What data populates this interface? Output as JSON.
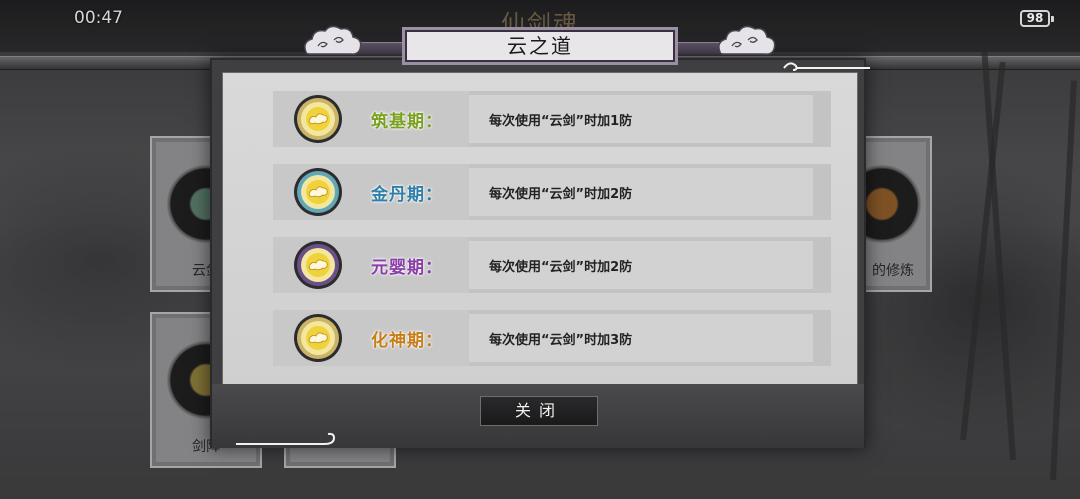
{
  "status_bar": {
    "time": "00:47",
    "battery": "98"
  },
  "background": {
    "game_title": "仙剑魂",
    "tiles": [
      {
        "label": "云剑"
      },
      {
        "label": "剑阵"
      },
      {
        "label": "的修炼"
      }
    ]
  },
  "dialog": {
    "title": "云之道",
    "rows": [
      {
        "stage": "筑基期：",
        "description": "每次使用“云剑”时加1防",
        "stage_color": "#7aa11e",
        "ring_color": "#c9b469"
      },
      {
        "stage": "金丹期：",
        "description": "每次使用“云剑”时加2防",
        "stage_color": "#2f7fa8",
        "ring_color": "#5fa7b9"
      },
      {
        "stage": "元婴期：",
        "description": "每次使用“云剑”时加2防",
        "stage_color": "#8a3ea8",
        "ring_color": "#6b4f8a"
      },
      {
        "stage": "化神期：",
        "description": "每次使用“云剑”时加3防",
        "stage_color": "#c87e17",
        "ring_color": "#c9b469"
      }
    ],
    "close_label": "关闭"
  },
  "colors": {
    "panel": "#d9d9d9",
    "frame": "#3f3f42",
    "header_plate": "#e9e6ea"
  }
}
